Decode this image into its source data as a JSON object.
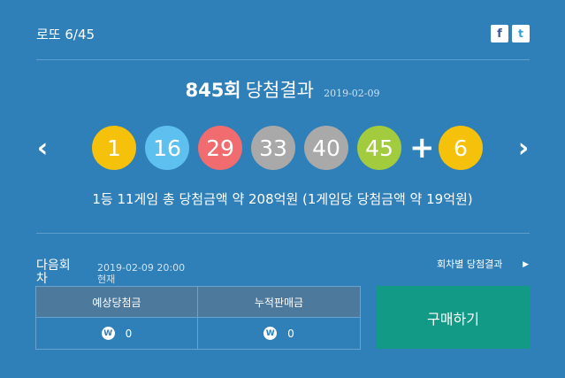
{
  "header": {
    "title": "로또 6/45",
    "facebook_icon": "f",
    "twitter_icon": "t"
  },
  "result": {
    "round": "845회",
    "label": "당첨결과",
    "date": "2019-02-09"
  },
  "balls": [
    {
      "number": "1",
      "color": "#f5c10a"
    },
    {
      "number": "16",
      "color": "#5ec0ee"
    },
    {
      "number": "29",
      "color": "#f06c6e"
    },
    {
      "number": "33",
      "color": "#a9a9a9"
    },
    {
      "number": "40",
      "color": "#a9a9a9"
    },
    {
      "number": "45",
      "color": "#a2cb3d"
    }
  ],
  "bonus": {
    "plus": "+",
    "number": "6",
    "color": "#f5c10a"
  },
  "prize_line": "1등 11게임 총 당첨금액 약 208억원 (1게임당 당첨금액 약 19억원)",
  "next_draw": {
    "label": "다음회차",
    "time": "2019-02-09 20:00 현재"
  },
  "history_link": {
    "label": "회차별 당첨결과",
    "caret": "▶"
  },
  "table": {
    "headers": [
      "예상당첨금",
      "누적판매금"
    ],
    "won_symbol": "W",
    "values": [
      "0",
      "0"
    ]
  },
  "buy_button": "구매하기",
  "nav": {
    "prev": "‹",
    "next": "›"
  }
}
